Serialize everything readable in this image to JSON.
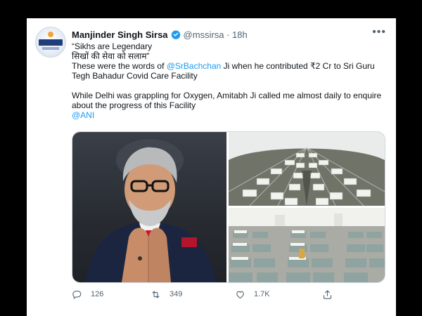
{
  "tweet": {
    "author_name": "Manjinder Singh Sirsa",
    "handle_time": "@mssirsa · 18h",
    "lines": {
      "l1": "“Sikhs are Legendary",
      "l2": "सिखों की सेवा को सलाम”",
      "l3a": "These were the words of ",
      "mention": "@SrBachchan",
      "l3b": " Ji when he contributed ₹2 Cr to Sri Guru Tegh Bahadur Covid Care Facility",
      "l4": "While Delhi was grappling for Oxygen, Amitabh Ji called me almost daily to enquire about the progress of this Facility",
      "tag": "@ANI"
    },
    "stats": {
      "replies": "126",
      "retweets": "349",
      "likes": "1.7K"
    }
  },
  "icons": {
    "verified": "verified-badge-icon",
    "more": "more-options-icon",
    "reply": "reply-icon",
    "retweet": "retweet-icon",
    "like": "heart-icon",
    "share": "share-icon"
  },
  "colors": {
    "link": "#1d9bf0",
    "text": "#0f1419",
    "secondary": "#536471",
    "frame": "#000000"
  }
}
